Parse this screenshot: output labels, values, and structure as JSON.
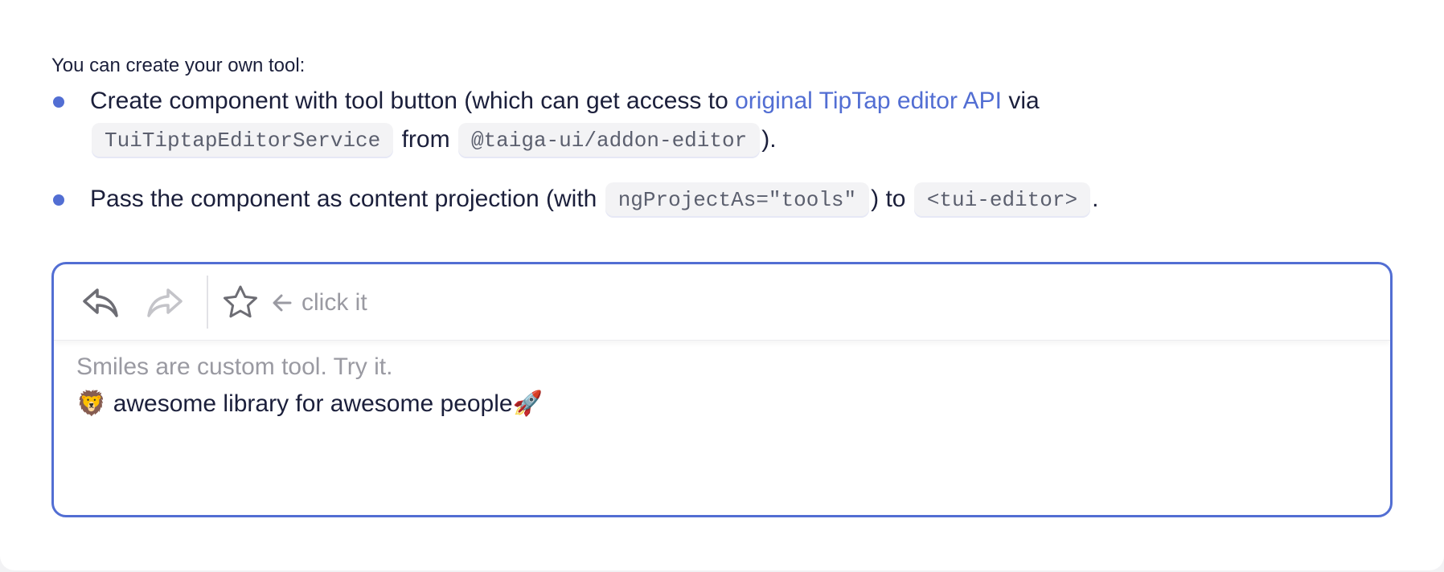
{
  "intro": "You can create your own tool:",
  "steps": [
    {
      "text_before": "Create component with tool button (which can get access to ",
      "link_text": "original TipTap editor API",
      "text_via": " via",
      "code_service": "TuiTiptapEditorService",
      "text_from": " from ",
      "code_package": "@taiga-ui/addon-editor",
      "text_end": ")."
    },
    {
      "text_before": "Pass the component as content projection (with ",
      "code_attr": "ngProjectAs=\"tools\"",
      "text_to": ") to ",
      "code_tag": "<tui-editor>",
      "text_end": "."
    }
  ],
  "editor": {
    "toolbar": {
      "undo_icon": "undo-icon",
      "redo_icon": "redo-icon",
      "star_icon": "star-icon",
      "arrow_icon": "arrow-left-icon",
      "hint": "click it"
    },
    "placeholder": "Smiles are custom tool. Try it.",
    "content": "🦁 awesome library for awesome people🚀"
  },
  "colors": {
    "accent": "#526ed3",
    "text": "#1b1f3b",
    "muted": "#9a9aa2"
  }
}
